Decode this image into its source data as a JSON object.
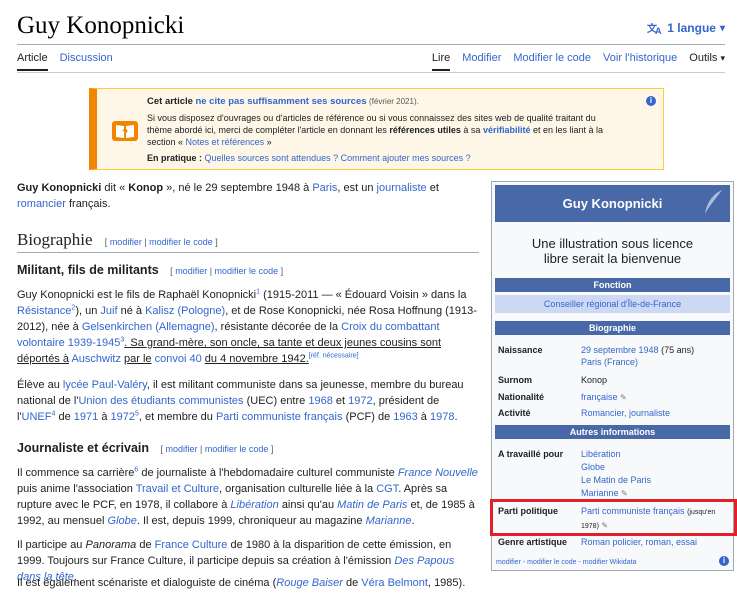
{
  "header": {
    "title": "Guy Konopnicki",
    "language_label": "1 langue"
  },
  "tabs": {
    "article": "Article",
    "discussion": "Discussion",
    "read": "Lire",
    "edit": "Modifier",
    "edit_code": "Modifier le code",
    "history": "Voir l'historique",
    "tools": "Outils"
  },
  "notice": {
    "title_a": "Cet article",
    "title_b": "ne cite pas suffisamment ses sources",
    "date": "(février 2021).",
    "line1": "Si vous disposez d'ouvrages ou d'articles de référence ou si vous connaissez des sites web de qualité traitant du",
    "line2a": "thème abordé ici, merci de compléter l'article en donnant les",
    "line2b": "références utiles",
    "line2c": "à sa",
    "line2d": "vérifiabilité",
    "line2e": "et en les liant à la",
    "line3a": "section «",
    "line3b": "Notes et références",
    "line3c": "»",
    "practice_label": "En pratique :",
    "practice_link1": "Quelles sources sont attendues ?",
    "practice_link2": "Comment ajouter mes sources ?"
  },
  "intro": {
    "name": "Guy Konopnicki",
    "t1": "dit «",
    "nick": "Konop",
    "t2": "», né le 29 septembre 1948 à",
    "paris": "Paris",
    "t3": ", est un",
    "journaliste": "journaliste",
    "t4": "et",
    "romancier": "romancier",
    "t5": "français."
  },
  "sections": {
    "biographie": "Biographie",
    "militant": "Militant, fils de militants",
    "journaliste": "Journaliste et écrivain",
    "edit_link": "modifier",
    "edit_code_link": "modifier le code"
  },
  "para1": {
    "a": "Guy Konopnicki est le fils de Raphaël Konopnicki",
    "s1": "1",
    "b": "(1915-2011 — « Édouard Voisin » dans la",
    "resistance": "Résistance",
    "s2": "2",
    "c": "), un",
    "juif": "Juif",
    "d": "né à",
    "kalisz": "Kalisz",
    "pologne": "(Pologne)",
    "e": ", et de Rose Konopnicki, née Rosa Hoffnung (1913-",
    "f": "2012), née à",
    "gelsenkirchen": "Gelsenkirchen",
    "allemagne": "(Allemagne)",
    "g": ", résistante décorée de la",
    "croix": "Croix du combattant volontaire",
    "years": "1939-1945",
    "s3": "3",
    "h": ". Sa grand-mère, son oncle, sa tante et deux jeunes cousins sont déportés à",
    "auschwitz": "Auschwitz",
    "i": "par le",
    "convoi": "convoi 40",
    "j": "du 4 novembre 1942.",
    "ref": "[réf. nécessaire]"
  },
  "para2": {
    "a": "Élève au",
    "lycee": "lycée Paul-Valéry",
    "b": ", il est militant communiste dans sa jeunesse, membre du bureau",
    "c": "national de l'",
    "uec": "Union des étudiants communistes",
    "d": "(UEC) entre",
    "y1968": "1968",
    "e": "et",
    "y1972": "1972",
    "f": ", président de l'",
    "unef": "UNEF",
    "s4": "4",
    "g": "de",
    "y1971": "1971",
    "h": "à",
    "y1972b": "1972",
    "s5": "5",
    "i": ", et membre du",
    "pcf": "Parti communiste français",
    "j": "(PCF) de",
    "y1963": "1963",
    "k": "à",
    "y1978": "1978",
    "l": "."
  },
  "para3": {
    "a": "Il commence sa carrière",
    "s6": "6",
    "b": "de journaliste à l'hebdomadaire culturel communiste",
    "fn": "France Nouvelle",
    "c": "puis",
    "d": "anime l'association",
    "tc": "Travail et Culture",
    "e": ", organisation culturelle liée à la",
    "cgt": "CGT",
    "f": ". Après sa rupture avec le",
    "g": "PCF, en 1978, il collabore à",
    "liberation": "Libération",
    "h": "ainsi qu'au",
    "matin": "Matin de Paris",
    "i": "et, de 1985 à 1992, au mensuel",
    "globe": "Globe",
    "j": ". Il est, depuis 1999, chroniqueur au magazine",
    "marianne": "Marianne",
    "k": "."
  },
  "para4": {
    "a": "Il participe au",
    "panorama": "Panorama",
    "b": "de",
    "fc": "France Culture",
    "c": "de 1980 à la disparition de cette émission, en 1999.",
    "d": "Toujours sur France Culture, il participe depuis sa création à l'émission",
    "papous": "Des Papous dans la tête",
    "e": "."
  },
  "para5": {
    "a": "Il est également scénariste et dialoguiste de cinéma (",
    "rouge": "Rouge Baiser",
    "b": "de",
    "vera": "Véra Belmont",
    "c": ", 1985)."
  },
  "infobox": {
    "title": "Guy Konopnicki",
    "noimg_1": "Une illustration sous licence",
    "noimg_2": "libre serait la bienvenue",
    "band_fonction": "Fonction",
    "role": "Conseiller régional d'Île-de-France",
    "band_bio": "Biographie",
    "naissance_k": "Naissance",
    "naissance_date": "29 septembre 1948",
    "naissance_age": "(75 ans)",
    "naissance_place": "Paris (France)",
    "surnom_k": "Surnom",
    "surnom_v": "Konop",
    "nationalite_k": "Nationalité",
    "nationalite_v": "française",
    "activite_k": "Activité",
    "activite_v": "Romancier, journaliste",
    "band_autres": "Autres informations",
    "travaille_k": "A travaillé pour",
    "travaille_1": "Libération",
    "travaille_2": "Globe",
    "travaille_3": "Le Matin de Paris",
    "travaille_4": "Marianne",
    "parti_k": "Parti politique",
    "parti_v": "Parti communiste français",
    "parti_note": "(jusqu'en",
    "parti_year": "1978)",
    "genre_k": "Genre artistique",
    "genre_v": "Roman policier, roman, essai",
    "footer": "modifier - modifier le code - modifier Wikidata"
  }
}
